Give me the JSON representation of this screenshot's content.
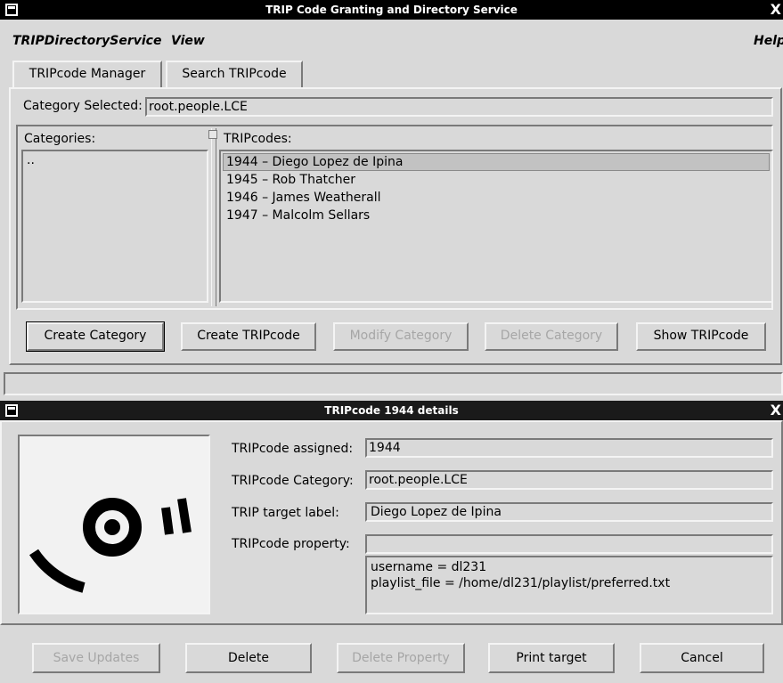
{
  "main_window": {
    "title": "TRIP Code Granting and Directory Service",
    "close_glyph": "X",
    "menu": {
      "service": "TRIPDirectoryService",
      "view": "View",
      "help": "Help"
    },
    "tabs": [
      "TRIPcode Manager",
      "Search TRIPcode"
    ],
    "category_selected_label": "Category Selected:",
    "category_selected_value": "root.people.LCE",
    "categories_label": "Categories:",
    "categories": [
      ".."
    ],
    "tripcodes_label": "TRIPcodes:",
    "tripcodes": [
      "1944 – Diego Lopez de Ipina",
      "1945 – Rob Thatcher",
      "1946 – James Weatherall",
      "1947 – Malcolm Sellars"
    ],
    "selected_tripcode_index": 0,
    "buttons": {
      "create_category": "Create Category",
      "create_tripcode": "Create TRIPcode",
      "modify_category": "Modify Category",
      "delete_category": "Delete Category",
      "show_tripcode": "Show TRIPcode"
    }
  },
  "details_window": {
    "title": "TRIPcode 1944 details",
    "close_glyph": "X",
    "fields": {
      "assigned_label": "TRIPcode assigned:",
      "assigned_value": "1944",
      "category_label": "TRIPcode Category:",
      "category_value": "root.people.LCE",
      "target_label": "TRIP target label:",
      "target_value": "Diego Lopez de Ipina",
      "property_label": "TRIPcode property:",
      "property_value": "",
      "properties": [
        "username = dl231",
        "playlist_file = /home/dl231/playlist/preferred.txt"
      ]
    },
    "buttons": {
      "save_updates": "Save Updates",
      "delete": "Delete",
      "delete_property": "Delete Property",
      "print_target": "Print target",
      "cancel": "Cancel"
    }
  },
  "icons": {
    "tripcode_target": "trip-target-icon",
    "window_menu": "window-menu-icon",
    "close": "close-icon"
  }
}
